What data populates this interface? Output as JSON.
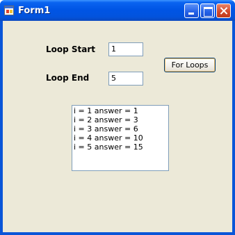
{
  "window": {
    "title": "Form1"
  },
  "form": {
    "loop_start_label": "Loop Start",
    "loop_start_value": "1",
    "loop_end_label": "Loop End",
    "loop_end_value": "5",
    "for_loops_button": "For Loops"
  },
  "results": [
    "i = 1 answer = 1",
    "i = 2 answer = 3",
    "i = 3 answer = 6",
    "i = 4 answer = 10",
    "i = 5 answer = 15"
  ]
}
